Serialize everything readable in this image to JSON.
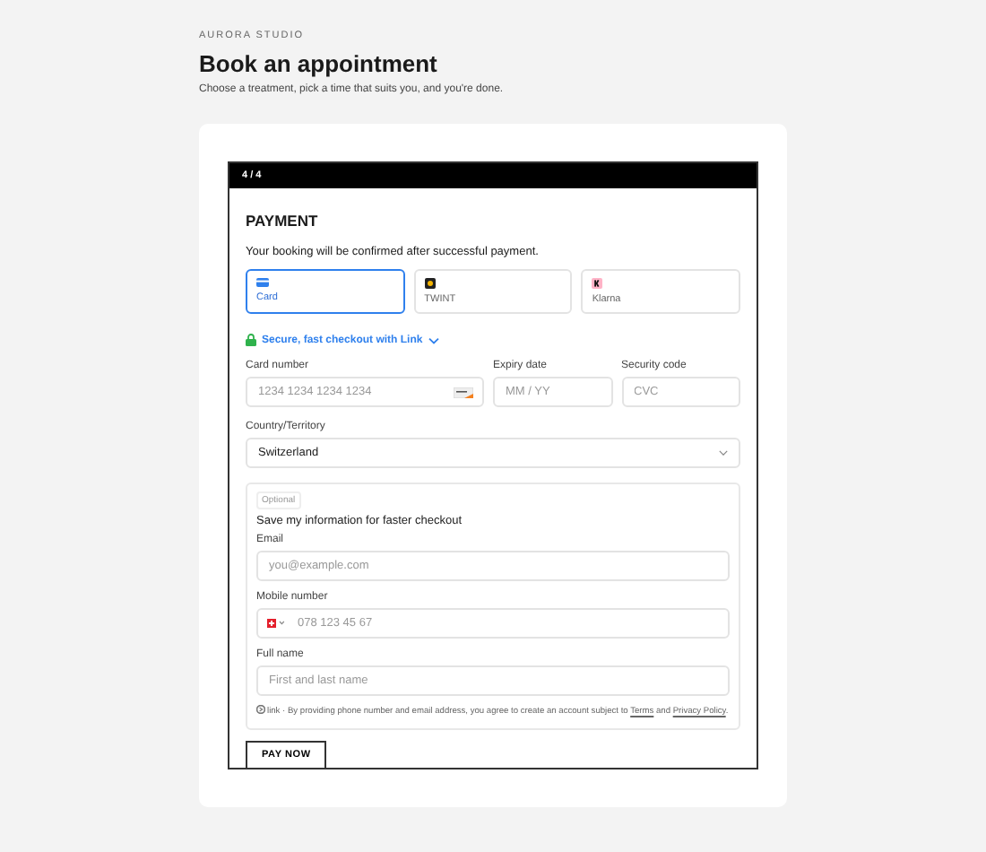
{
  "brand": "AURORA STUDIO",
  "title": "Book an appointment",
  "subtitle": "Choose a treatment, pick a time that suits you, and you're done.",
  "step": "4 / 4",
  "payment": {
    "heading": "PAYMENT",
    "note": "Your booking will be confirmed after successful payment.",
    "methods": [
      {
        "kind": "card",
        "label": "Card",
        "selected": true
      },
      {
        "kind": "twint",
        "label": "TWINT",
        "selected": false
      },
      {
        "kind": "klarna",
        "label": "Klarna",
        "selected": false
      }
    ],
    "link_banner": "Secure, fast checkout with Link",
    "card_number": {
      "label": "Card number",
      "placeholder": "1234 1234 1234 1234"
    },
    "expiry": {
      "label": "Expiry date",
      "placeholder": "MM / YY"
    },
    "cvc": {
      "label": "Security code",
      "placeholder": "CVC"
    },
    "country": {
      "label": "Country/Territory",
      "value": "Switzerland"
    },
    "save": {
      "badge": "Optional",
      "title": "Save my information for faster checkout",
      "email": {
        "label": "Email",
        "placeholder": "you@example.com"
      },
      "phone": {
        "label": "Mobile number",
        "placeholder": "078 123 45 67"
      },
      "name": {
        "label": "Full name",
        "placeholder": "First and last name"
      },
      "legal_brand": "link",
      "legal": [
        {
          "kind": "text",
          "text": "· By providing phone number and email address, you agree to create an account subject to "
        },
        {
          "kind": "link",
          "text": "Terms"
        },
        {
          "kind": "text",
          "text": " and "
        },
        {
          "kind": "link",
          "text": "Privacy Policy"
        },
        {
          "kind": "text",
          "text": "."
        }
      ]
    },
    "button": "PAY NOW"
  }
}
